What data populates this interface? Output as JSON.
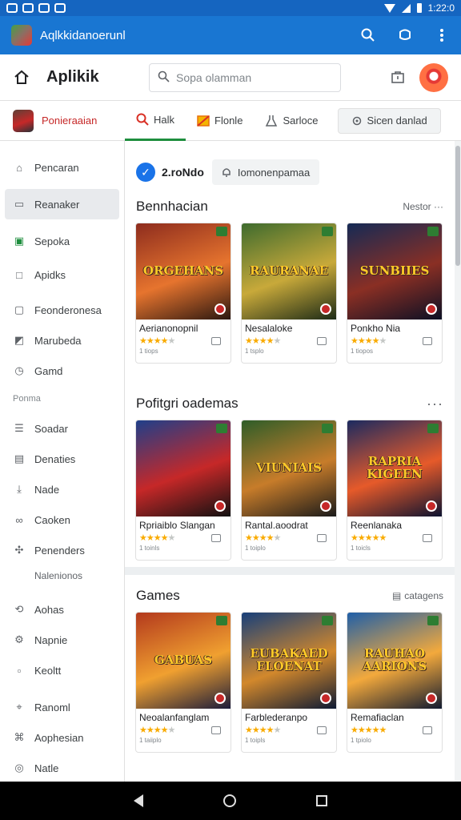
{
  "statusbar": {
    "time": "1:22:0"
  },
  "appbar": {
    "title": "Aqlkkidanoerunl"
  },
  "header": {
    "brand": "Aplikik",
    "search_placeholder": "Sopa olamman"
  },
  "tabs": {
    "pinned_label": "Ponieraaian",
    "items": [
      {
        "label": "Halk",
        "icon": "search-icon",
        "active": true
      },
      {
        "label": "Flonle",
        "icon": "gift-icon",
        "active": false
      },
      {
        "label": "Sarloce",
        "icon": "flask-icon",
        "active": false
      },
      {
        "label": "Sicen danlad",
        "icon": "settings-icon",
        "active": false
      }
    ]
  },
  "sidebar": {
    "items": [
      {
        "label": "Pencaran",
        "icon": "home-icon"
      },
      {
        "label": "Reanaker",
        "icon": "folder-icon",
        "active": true
      },
      {
        "label": "Sepoka",
        "icon": "calendar-icon"
      },
      {
        "label": "Apidks",
        "icon": "square-icon"
      }
    ],
    "items2": [
      {
        "label": "Feonderonesa",
        "icon": "bookmark-icon"
      },
      {
        "label": "Marubeda",
        "icon": "image-icon"
      },
      {
        "label": "Gamd",
        "icon": "history-icon"
      }
    ],
    "section": "Ponma",
    "items3": [
      {
        "label": "Soadar",
        "icon": "list-icon"
      },
      {
        "label": "Denaties",
        "icon": "chart-icon"
      },
      {
        "label": "Nade",
        "icon": "download-icon"
      },
      {
        "label": "Caoken",
        "icon": "link-icon"
      },
      {
        "label": "Penenders",
        "icon": "puzzle-icon"
      }
    ],
    "subitem": "Nalenionos",
    "items4": [
      {
        "label": "Aohas",
        "icon": "share-icon"
      },
      {
        "label": "Napnie",
        "icon": "gear-icon"
      },
      {
        "label": "Keoltt",
        "icon": "doc-icon"
      },
      {
        "label": "Ranoml",
        "icon": "tag-icon"
      },
      {
        "label": "Aophesian",
        "icon": "group-icon"
      },
      {
        "label": "Natle",
        "icon": "circle-icon"
      }
    ]
  },
  "topline": {
    "count": "2.roNdo",
    "chip": "Iomonenpamaa"
  },
  "sections": [
    {
      "title": "Bennhacian",
      "more": "Nestor ···",
      "cards": [
        {
          "name": "Aerianonopnil",
          "logo": "ORGEHANS",
          "rating": 4,
          "size": "1 tiops",
          "colors": [
            "#8d2c1e",
            "#e6742e",
            "#2b1710"
          ]
        },
        {
          "name": "Nesalaloke",
          "logo": "RAURANAE",
          "rating": 4,
          "size": "1 tsplo",
          "colors": [
            "#3e6b2e",
            "#c8a93a",
            "#1d2b17"
          ]
        },
        {
          "name": "Ponkho Nia",
          "logo": "SUNBIIES",
          "rating": 4,
          "size": "1 tiopos",
          "colors": [
            "#152a55",
            "#8a2f24",
            "#0c1024"
          ]
        }
      ]
    },
    {
      "title": "Pofitgri oademas",
      "more": "···",
      "cards": [
        {
          "name": "Rpriaiblo Slangan",
          "logo": "",
          "rating": 4,
          "size": "1 toinls",
          "colors": [
            "#1f3f8a",
            "#c62828",
            "#111"
          ]
        },
        {
          "name": "Rantal.aoodrat",
          "logo": "VIUNIAIS",
          "rating": 4,
          "size": "1 toiplo",
          "colors": [
            "#2e5d29",
            "#c77c2a",
            "#1a1a1a"
          ]
        },
        {
          "name": "Reenlanaka",
          "logo": "RAPRIA KIGEEN",
          "rating": 5,
          "size": "1 toicls",
          "colors": [
            "#1b2a60",
            "#e65a2a",
            "#0d1330"
          ]
        }
      ]
    },
    {
      "title": "Games",
      "more": "catagens",
      "cards": [
        {
          "name": "Neoalanfanglam",
          "logo": "GABUAS",
          "rating": 4,
          "size": "1 taiiplo",
          "colors": [
            "#b3391d",
            "#f0a030",
            "#1c1c3a"
          ]
        },
        {
          "name": "Farblederanpo",
          "logo": "EUBAKAED FLOENAT",
          "rating": 4,
          "size": "1 toipls",
          "colors": [
            "#173f7a",
            "#d2882c",
            "#0e1a33"
          ]
        },
        {
          "name": "Remafiaclan",
          "logo": "RAUHAO AARIONS",
          "rating": 5,
          "size": "1 tpiolo",
          "colors": [
            "#1f5fa8",
            "#f3a93c",
            "#111a30"
          ]
        }
      ]
    }
  ]
}
